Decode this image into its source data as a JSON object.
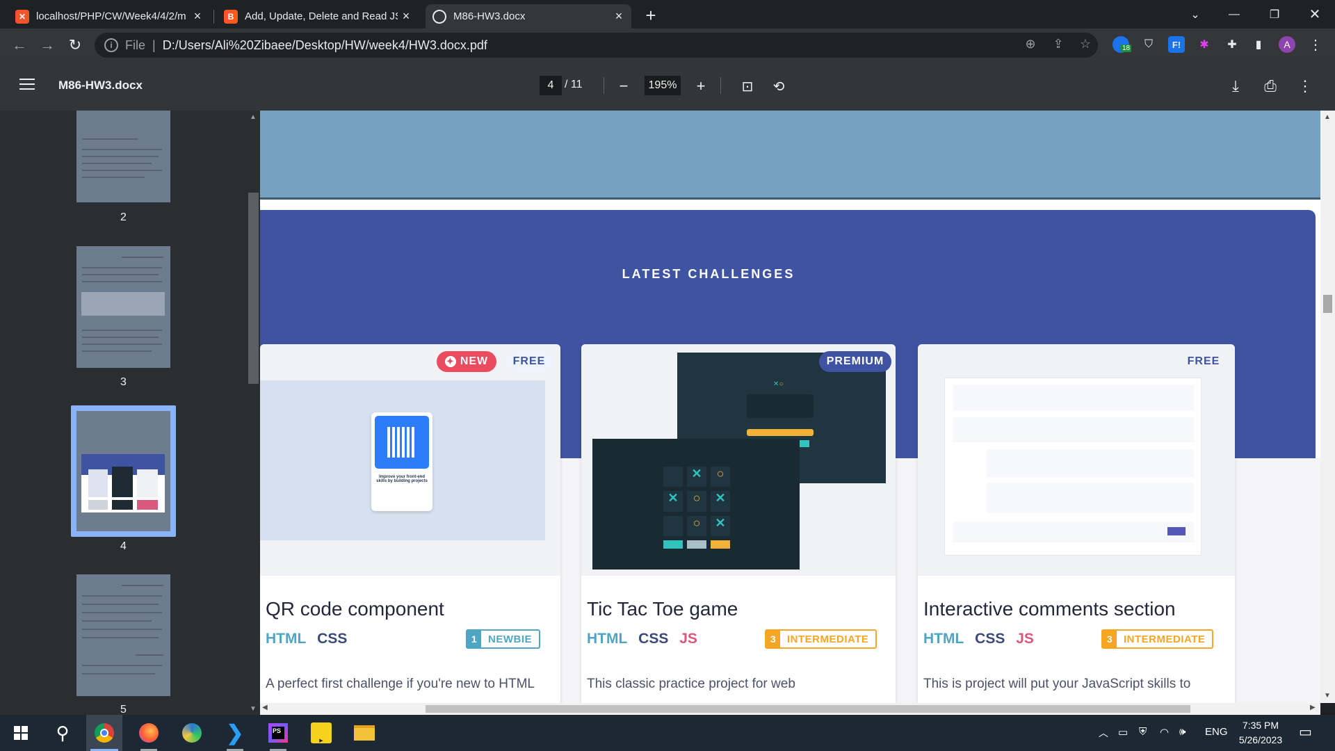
{
  "browser": {
    "tabs": [
      {
        "title": "localhost/PHP/CW/Week4/4/2/m",
        "favicon": "xampp-icon",
        "color": "#f2552c",
        "active": false
      },
      {
        "title": "Add, Update, Delete and Read JS",
        "favicon": "blogger-icon",
        "color": "#ff5722",
        "active": false
      },
      {
        "title": "M86-HW3.docx",
        "favicon": "globe-icon",
        "color": "#e8eaed",
        "active": true
      }
    ],
    "new_tab": "+",
    "address": {
      "scheme_label": "File",
      "url": "D:/Users/Ali%20Zibaee/Desktop/HW/week4/HW3.docx.pdf"
    },
    "extension_badge": "18",
    "profile_initial": "A"
  },
  "pdf": {
    "title": "M86-HW3.docx",
    "page_current": "4",
    "page_total": "/ 11",
    "zoom": "195%",
    "thumbnail_numbers": [
      "2",
      "3",
      "4",
      "5"
    ]
  },
  "content": {
    "hero_title": "LATEST CHALLENGES",
    "badges": {
      "new": "NEW",
      "free": "FREE",
      "premium": "PREMIUM"
    },
    "cards": [
      {
        "title": "QR code component",
        "tags": [
          "HTML",
          "CSS"
        ],
        "level_num": "1",
        "level": "NEWBIE",
        "level_color": "#4fa6c4",
        "description": "A perfect first challenge if you're new to HTML",
        "qr_caption": "Improve your front-end skills by building projects"
      },
      {
        "title": "Tic Tac Toe game",
        "tags": [
          "HTML",
          "CSS",
          "JS"
        ],
        "level_num": "3",
        "level": "INTERMEDIATE",
        "level_color": "#f5a623",
        "description": "This classic practice project for web"
      },
      {
        "title": "Interactive comments section",
        "tags": [
          "HTML",
          "CSS",
          "JS"
        ],
        "level_num": "3",
        "level": "INTERMEDIATE",
        "level_color": "#f5a623",
        "description": "This is project will put your JavaScript skills to"
      }
    ]
  },
  "taskbar": {
    "language": "ENG",
    "time": "7:35 PM",
    "date": "5/26/2023"
  }
}
